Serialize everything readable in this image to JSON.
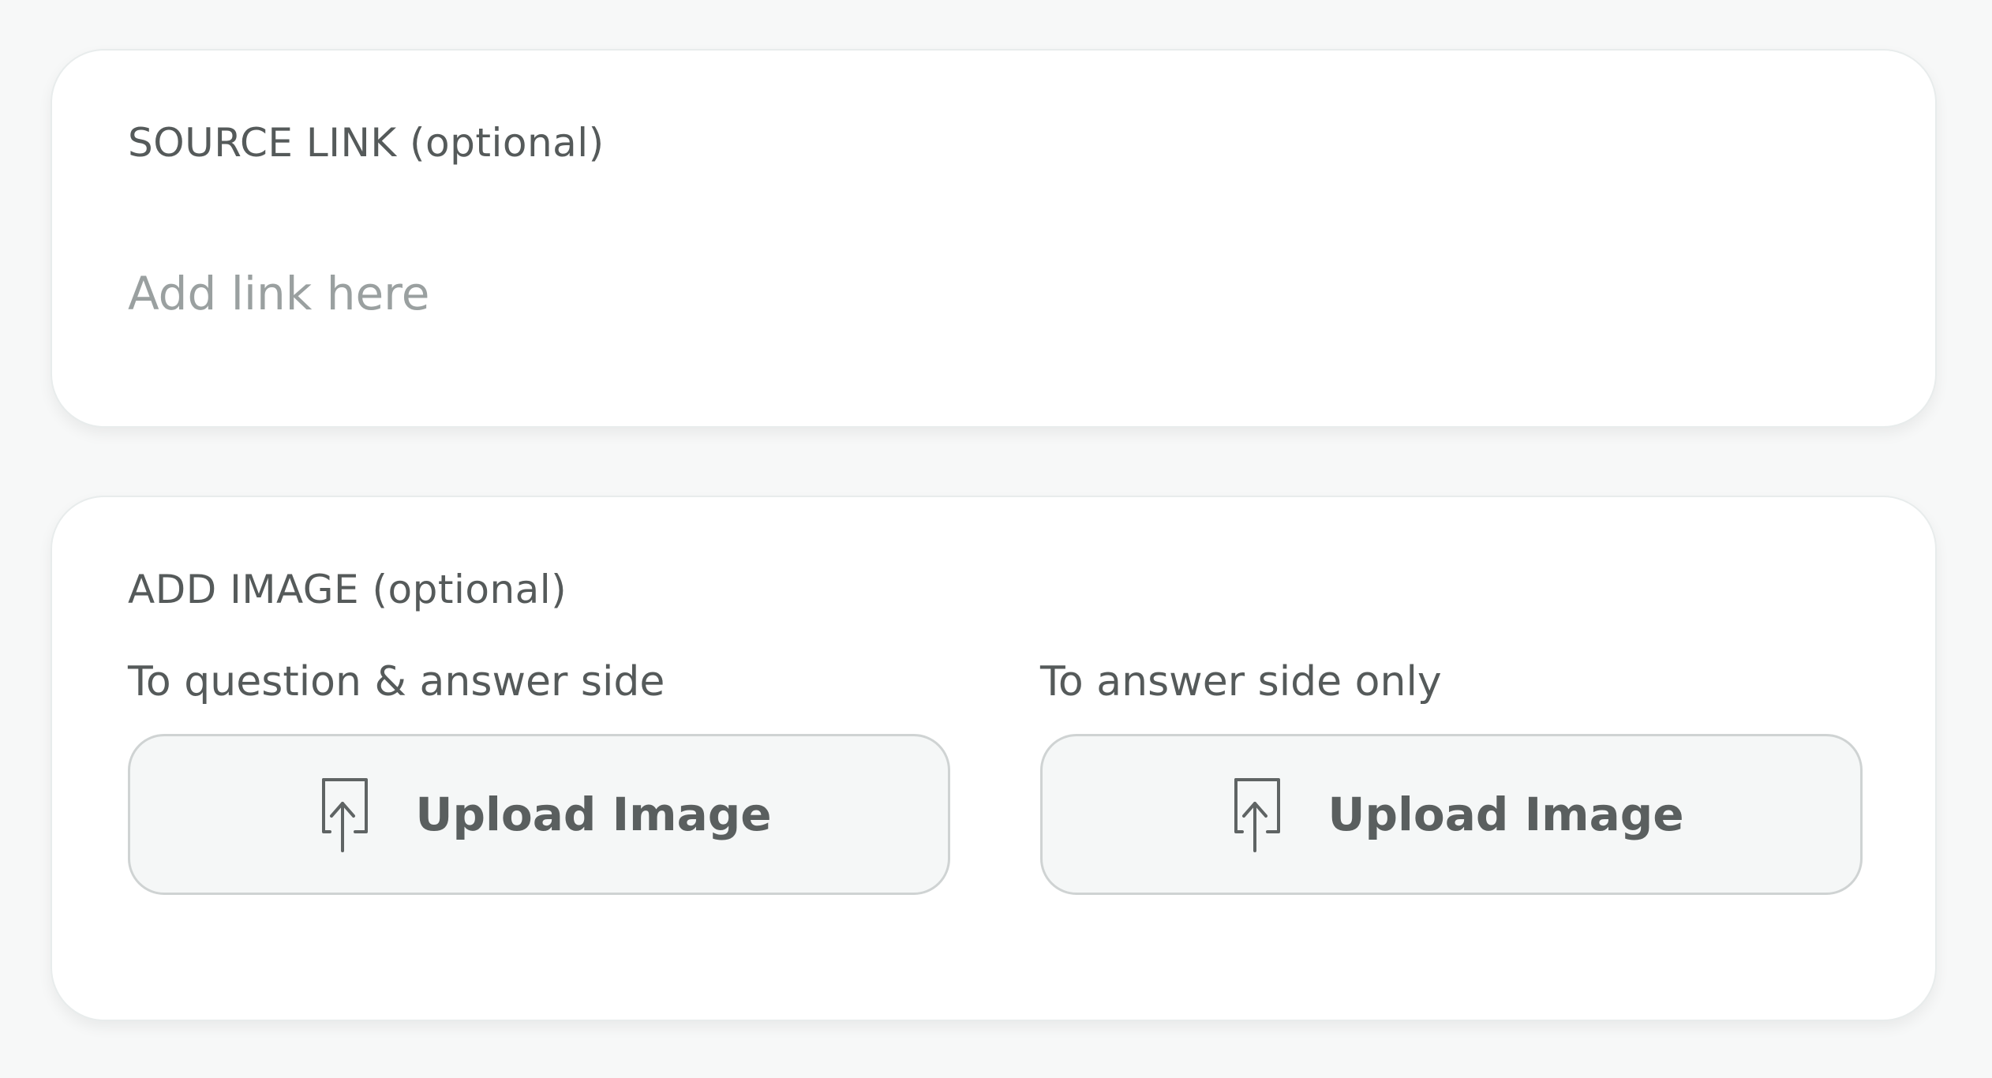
{
  "source_link": {
    "label": "SOURCE LINK (optional)",
    "input_value": "",
    "input_placeholder": "Add link here"
  },
  "add_image": {
    "label": "ADD IMAGE (optional)",
    "options": [
      {
        "sublabel": "To question & answer side",
        "button_label": "Upload Image",
        "icon": "upload-icon"
      },
      {
        "sublabel": "To answer side only",
        "button_label": "Upload Image",
        "icon": "upload-icon"
      }
    ]
  },
  "colors": {
    "background": "#f7f8f8",
    "card": "#ffffff",
    "label_text": "#555a5a",
    "placeholder": "#9aa0a0",
    "button_bg": "#f5f7f7",
    "button_border": "#cfd3d3"
  }
}
